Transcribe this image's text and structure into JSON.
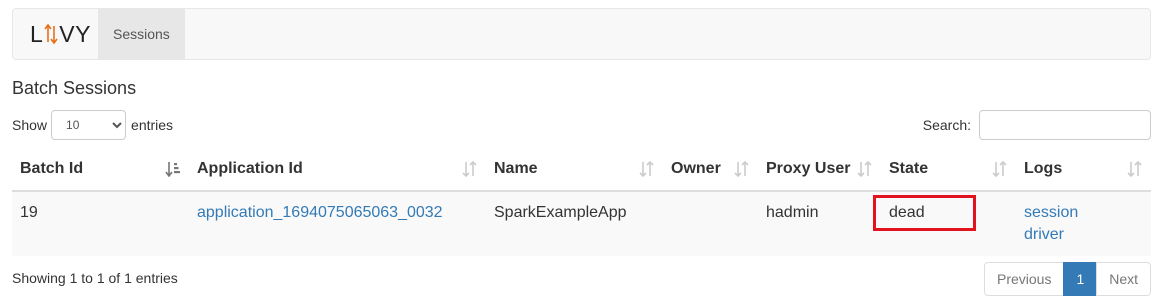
{
  "nav": {
    "brand_letters": [
      "L",
      "VY"
    ],
    "sessions_label": "Sessions"
  },
  "page": {
    "title": "Batch Sessions"
  },
  "length_control": {
    "prefix": "Show",
    "selected": "10",
    "suffix": "entries"
  },
  "search": {
    "label": "Search:",
    "value": ""
  },
  "table": {
    "columns": [
      "Batch Id",
      "Application Id",
      "Name",
      "Owner",
      "Proxy User",
      "State",
      "Logs"
    ],
    "rows": [
      {
        "batch_id": "19",
        "application_id": "application_1694075065063_0032",
        "name": "SparkExampleApp",
        "owner": "",
        "proxy_user": "hadmin",
        "state": "dead",
        "logs": [
          "session",
          "driver"
        ]
      }
    ]
  },
  "info": "Showing 1 to 1 of 1 entries",
  "pagination": {
    "previous": "Previous",
    "current": "1",
    "next": "Next"
  },
  "colors": {
    "link": "#337ab7",
    "highlight": "#e0131e",
    "logo_accent": "#e8701a"
  }
}
